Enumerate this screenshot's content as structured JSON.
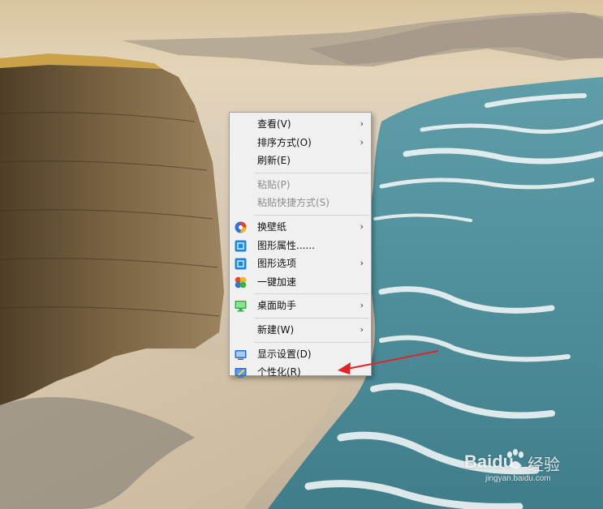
{
  "menu": {
    "items": [
      {
        "label": "查看(V)",
        "submenu": true,
        "icon": null
      },
      {
        "label": "排序方式(O)",
        "submenu": true,
        "icon": null
      },
      {
        "label": "刷新(E)",
        "submenu": false,
        "icon": null
      },
      {
        "label": "粘贴(P)",
        "submenu": false,
        "icon": null,
        "disabled": true
      },
      {
        "label": "粘贴快捷方式(S)",
        "submenu": false,
        "icon": null,
        "disabled": true
      },
      {
        "label": "换壁纸",
        "submenu": true,
        "icon": "wallpaper-app-icon"
      },
      {
        "label": "图形属性......",
        "submenu": false,
        "icon": "intel-graphics-icon"
      },
      {
        "label": "图形选项",
        "submenu": true,
        "icon": "intel-graphics-icon"
      },
      {
        "label": "一键加速",
        "submenu": false,
        "icon": "speedup-icon"
      },
      {
        "label": "桌面助手",
        "submenu": true,
        "icon": "desktop-assistant-icon"
      },
      {
        "label": "新建(W)",
        "submenu": true,
        "icon": null
      },
      {
        "label": "显示设置(D)",
        "submenu": false,
        "icon": "display-settings-icon"
      },
      {
        "label": "个性化(R)",
        "submenu": false,
        "icon": "personalize-icon"
      }
    ],
    "arrow_glyph": "›"
  },
  "watermark": {
    "brand": "Baidu",
    "suffix": "经验",
    "sub": "jingyan.baidu.com"
  },
  "colors": {
    "menu_bg": "#f0f0f0",
    "annotation_arrow": "#e0242a"
  }
}
